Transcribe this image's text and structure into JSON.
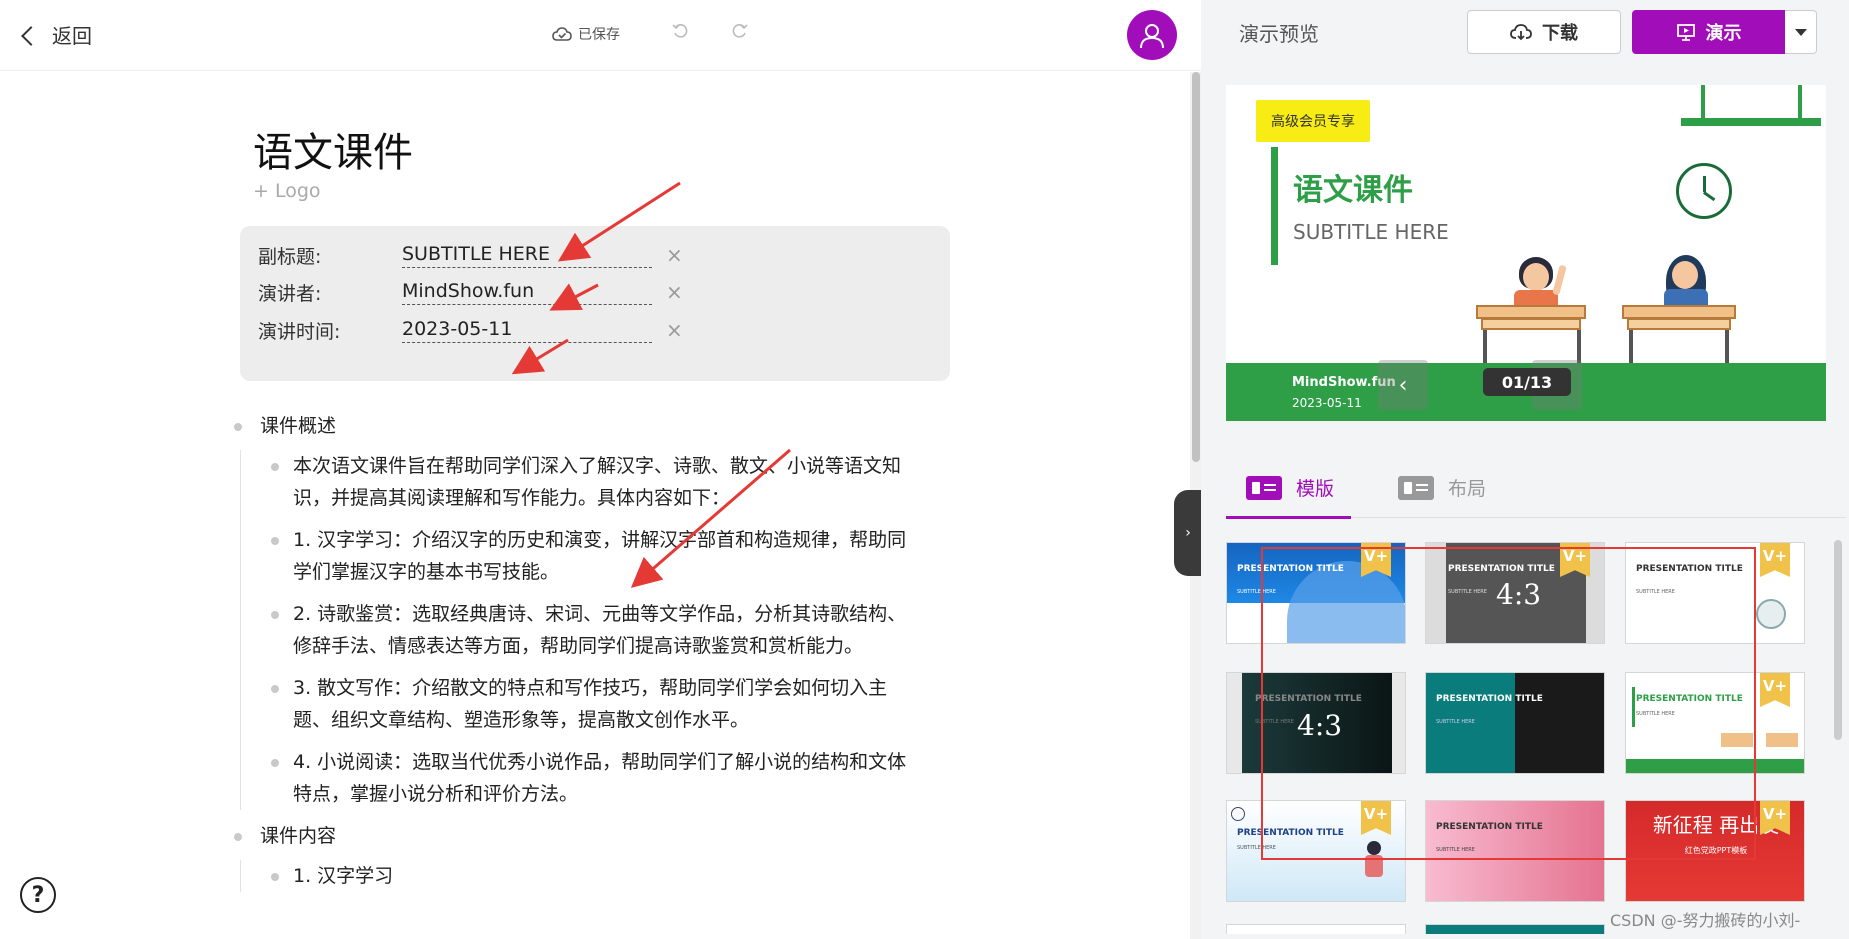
{
  "topbar": {
    "back_label": "返回",
    "saved_label": "已保存"
  },
  "document": {
    "title": "语文课件",
    "add_logo": "+ Logo",
    "meta": [
      {
        "label": "副标题:",
        "value": "SUBTITLE HERE"
      },
      {
        "label": "演讲者:",
        "value": "MindShow.fun"
      },
      {
        "label": "演讲时间:",
        "value": "2023-05-11"
      }
    ],
    "clear_symbol": "×",
    "outline": {
      "section1": "课件概述",
      "children": [
        "本次语文课件旨在帮助同学们深入了解汉字、诗歌、散文、小说等语文知识，并提高其阅读理解和写作能力。具体内容如下：",
        "1. 汉字学习：介绍汉字的历史和演变，讲解汉字部首和构造规律，帮助同学们掌握汉字的基本书写技能。",
        "2. 诗歌鉴赏：选取经典唐诗、宋词、元曲等文学作品，分析其诗歌结构、修辞手法、情感表达等方面，帮助同学们提高诗歌鉴赏和赏析能力。",
        "3. 散文写作：介绍散文的特点和写作技巧，帮助同学们学会如何切入主题、组织文章结构、塑造形象等，提高散文创作水平。",
        "4. 小说阅读：选取当代优秀小说作品，帮助同学们了解小说的结构和文体特点，掌握小说分析和评价方法。"
      ],
      "section2": "课件内容",
      "section2_child": "1. 汉字学习"
    }
  },
  "preview": {
    "title": "演示预览",
    "download_label": "下载",
    "present_label": "演示",
    "slide": {
      "vip_badge": "高级会员专享",
      "title": "语文课件",
      "subtitle": "SUBTITLE HERE",
      "presenter": "MindShow.fun",
      "date": "2023-05-11",
      "pager": "01/13"
    }
  },
  "tabs": {
    "templates": "模版",
    "layout": "布局"
  },
  "templates": [
    {
      "title": "PRESENTATION TITLE",
      "sub": "SUBTITLE HERE",
      "badge": "V+"
    },
    {
      "title": "PRESENTATION TITLE",
      "sub": "SUBTITLE HERE",
      "badge": "V+",
      "ratio": "4:3"
    },
    {
      "title": "PRESENTATION TITLE",
      "sub": "SUBTITLE HERE",
      "badge": "V+"
    },
    {
      "title": "PRESENTATION TITLE",
      "sub": "SUBTITLE HERE",
      "ratio": "4:3"
    },
    {
      "title": "PRESENTATION TITLE",
      "sub": "SUBTITLE HERE"
    },
    {
      "title": "PRESENTATION TITLE",
      "sub": "SUBTITLE HERE",
      "badge": "V+"
    },
    {
      "title": "PRESENTATION TITLE",
      "sub": "SUBTITLE HERE",
      "badge": "V+"
    },
    {
      "title": "PRESENTATION TITLE",
      "sub": "SUBTITLE HERE"
    },
    {
      "title": "新征程 再出发",
      "sub": "红色党政PPT模板",
      "badge": "V+"
    }
  ],
  "watermark": "CSDN @-努力搬砖的小刘-",
  "colors": {
    "accent": "#a10eb9",
    "slide_green": "#2e9e47",
    "annotation_red": "#e53935"
  }
}
